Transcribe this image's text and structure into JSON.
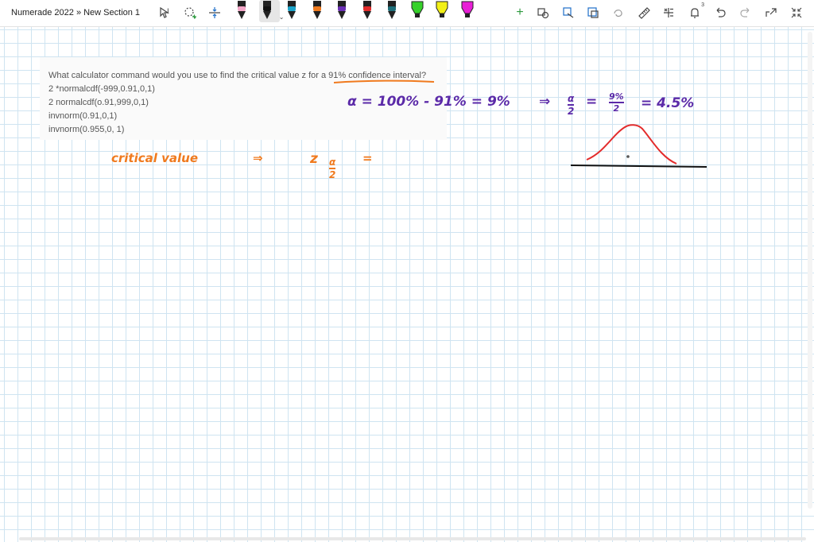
{
  "toolbar": {
    "title": "Numerade 2022 » New Section 1",
    "tools": [
      "select-text-icon",
      "lasso-icon",
      "insert-space-icon"
    ],
    "pens": [
      {
        "name": "pen-light-pink",
        "color": "#f4a6c8",
        "selected": false
      },
      {
        "name": "pen-black",
        "color": "#111111",
        "selected": true
      },
      {
        "name": "pen-teal",
        "color": "#1aa3c9",
        "selected": false
      },
      {
        "name": "pen-orange",
        "color": "#f07a1e",
        "selected": false
      },
      {
        "name": "pen-purple",
        "color": "#6b2fb5",
        "selected": false
      },
      {
        "name": "pen-red",
        "color": "#e32b2b",
        "selected": false
      },
      {
        "name": "pen-dark-teal",
        "color": "#1e6f7a",
        "selected": false
      },
      {
        "name": "highlighter-green",
        "color": "#36d12a",
        "selected": false
      },
      {
        "name": "highlighter-yellow",
        "color": "#f2f016",
        "selected": false
      },
      {
        "name": "highlighter-magenta",
        "color": "#e81fd6",
        "selected": false
      }
    ],
    "right_tools": [
      "add-pen-icon",
      "ink-to-shape-icon",
      "ink-to-text-icon",
      "crop-icon",
      "ink-replay-icon",
      "ruler-icon",
      "math-icon",
      "notifications-icon",
      "undo-icon",
      "redo-icon",
      "share-icon",
      "fullscreen-icon"
    ],
    "notification_count": "3"
  },
  "question": {
    "prompt": "What calculator command would you use to find the critical value z for a 91% confidence interval?",
    "options": [
      "2 *normalcdf(-999,0.91,0,1)",
      "2 normalcdf(o.91,999,0,1)",
      "invnorm(0.91,0,1)",
      "invnorm(0.955,0, 1)"
    ]
  },
  "handwriting": {
    "alpha_equation": "α = 100% - 91% = 9%",
    "arrow1": "⇒",
    "half_alpha_num": "α",
    "half_alpha_den": "2",
    "equals": "=",
    "nine_percent": "9%",
    "two": "2",
    "result": "= 4.5%",
    "critical_label": "critical value",
    "arrow2": "⇒",
    "z": "z",
    "z_sub_num": "α",
    "z_sub_den": "2",
    "trailing_equals": "="
  },
  "colors": {
    "purple_ink": "#5b2aa8",
    "orange_ink": "#f07a1e",
    "red_ink": "#e32b2b",
    "grid": "#cfe4f1"
  }
}
